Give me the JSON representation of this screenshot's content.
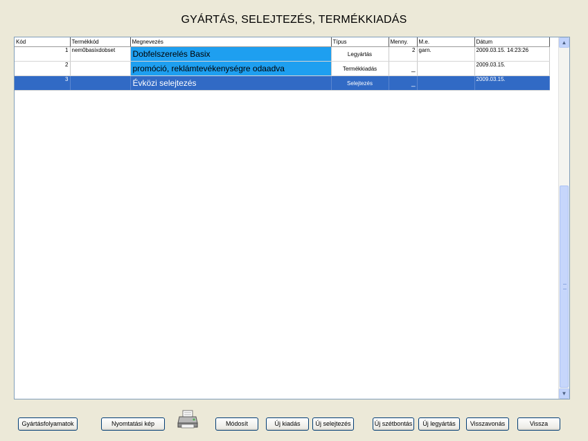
{
  "title": "GYÁRTÁS, SELEJTEZÉS, TERMÉKKIADÁS",
  "grid": {
    "columns": [
      "Kód",
      "Termékkód",
      "Megnevezés",
      "Típus",
      "Menny.",
      "M.e.",
      "Dátum"
    ],
    "rows": [
      {
        "kod": "1",
        "termekkod": "nem0basixdobset",
        "megnevezes": "Dobfelszerelés Basix",
        "tipus": "Legyártás",
        "menny": "2",
        "me": "garn.",
        "datum": "2009.03.15. 14:23:26"
      },
      {
        "kod": "2",
        "termekkod": "",
        "megnevezes": "promóció, reklámtevékenységre odaadva",
        "tipus": "Termékkiadás",
        "menny": "_",
        "me": "",
        "datum": "2009.03.15."
      },
      {
        "kod": "3",
        "termekkod": "",
        "megnevezes": "Évközi selejtezés",
        "tipus": "Selejtezés",
        "menny": "_",
        "me": "",
        "datum": "2009.03.15."
      }
    ],
    "selected_row": 3
  },
  "buttons": {
    "gyartasfolyamatok": "Gyártásfolyamatok",
    "nyomtatasi_kep": "Nyomtatási kép",
    "modosit": "Módosít",
    "uj_kiadas": "Új kiadás",
    "uj_selejtezes": "Új selejtezés",
    "uj_szetbontas": "Új szétbontás",
    "uj_legyartas": "Új legyártás",
    "visszavonas": "Visszavonás",
    "vissza": "Vissza"
  },
  "icons": {
    "printer": "printer-icon",
    "scroll_up": "scroll-up-arrow-icon",
    "scroll_down": "scroll-down-arrow-icon"
  },
  "colors": {
    "background": "#ece9d8",
    "name_cell": "#1e9ff0",
    "selected_row": "#316ac5",
    "button_border": "#003c74"
  }
}
